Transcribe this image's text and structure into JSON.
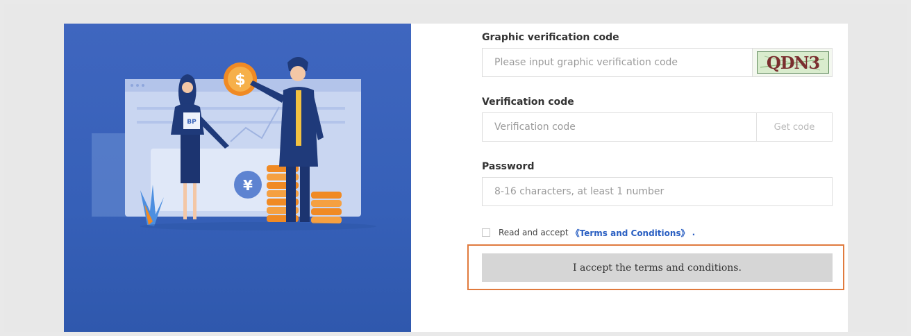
{
  "form": {
    "captcha": {
      "label": "Graphic verification code",
      "placeholder": "Please input graphic verification code",
      "image_text": "QDN3"
    },
    "verification": {
      "label": "Verification code",
      "placeholder": "Verification code",
      "get_code_label": "Get code"
    },
    "password": {
      "label": "Password",
      "placeholder": "8-16 characters, at least 1 number"
    },
    "agreement": {
      "prefix": "Read and accept",
      "terms_link": "《Terms and Conditions》",
      "suffix": "."
    },
    "accept_button": "I accept the terms and conditions."
  },
  "hero": {
    "badge_text": "BP",
    "coin_symbol": "$",
    "yen_symbol": "¥"
  },
  "colors": {
    "hero_blue": "#3762b8",
    "link_blue": "#2a5fc2",
    "highlight_orange": "#e07a3d",
    "button_gray": "#d6d6d6",
    "coin_orange": "#f08a24"
  }
}
